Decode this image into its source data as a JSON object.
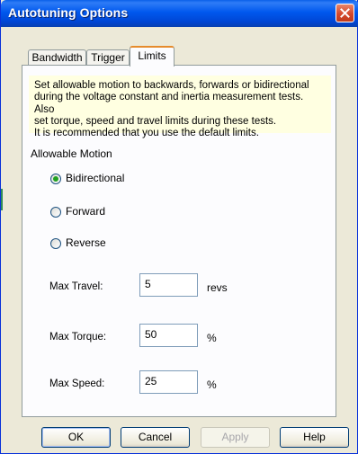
{
  "window": {
    "title": "Autotuning Options"
  },
  "tabs": [
    {
      "label": "Bandwidth"
    },
    {
      "label": "Trigger"
    },
    {
      "label": "Limits"
    }
  ],
  "info": {
    "lines": [
      "Set allowable motion to backwards, forwards or bidirectional",
      "during the voltage constant and inertia measurement tests. Also",
      "set torque, speed and travel limits during these tests.",
      "It is recommended that you use the default limits."
    ]
  },
  "motion": {
    "label": "Allowable Motion",
    "options": [
      {
        "label": "Bidirectional",
        "selected": true
      },
      {
        "label": "Forward",
        "selected": false
      },
      {
        "label": "Reverse",
        "selected": false
      }
    ]
  },
  "limits": {
    "travel": {
      "label": "Max Travel:",
      "value": "5",
      "unit": "revs"
    },
    "torque": {
      "label": "Max Torque:",
      "value": "50",
      "unit": "%"
    },
    "speed": {
      "label": "Max Speed:",
      "value": "25",
      "unit": "%"
    }
  },
  "buttons": {
    "ok": "OK",
    "cancel": "Cancel",
    "apply": "Apply",
    "help": "Help"
  },
  "colors": {
    "titlebar": "#0058ee",
    "info_background": "#ffffe1",
    "radio_selected": "#21a121",
    "active_tab_accent": "#e68b2c"
  }
}
